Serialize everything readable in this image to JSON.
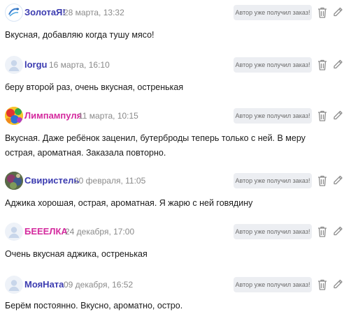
{
  "badge_label": "Автор уже получил заказ!",
  "colors": {
    "author_default": "#3b3bb0",
    "author_pink": "#d42a9e",
    "author_purple": "#8c2ae8",
    "date": "#8a8a8a",
    "badge_bg": "#eceef2"
  },
  "icons": {
    "delete": "trash-icon",
    "edit": "pencil-icon"
  },
  "reviews": [
    {
      "author": "ЗолотаЯ!",
      "date": "28 марта, 13:32",
      "text": "Вкусная, добавляю когда тушу мясо!"
    },
    {
      "author": "lorgu",
      "date": "16 марта, 16:10",
      "text": "беру второй раз, очень вкусная, остренькая"
    },
    {
      "author": "Лимпампуля",
      "date": "11 марта, 10:15",
      "text": "Вкусная. Даже ребёнок заценил, бутерброды теперь только с ней. В меру острая, ароматная. Заказала повторно."
    },
    {
      "author": "Свиристель",
      "date": "20 февраля, 11:05",
      "text": "Аджика хорошая, острая, ароматная. Я жарю с ней говядину"
    },
    {
      "author": "БЕЕЕЛКА",
      "date": "24 декабря, 17:00",
      "text": "Очень вкусная аджика, остренькая"
    },
    {
      "author": "МояНата",
      "date": "09 декабря, 16:52",
      "text": "Берём постоянно. Вкусно, ароматно, остро."
    }
  ]
}
